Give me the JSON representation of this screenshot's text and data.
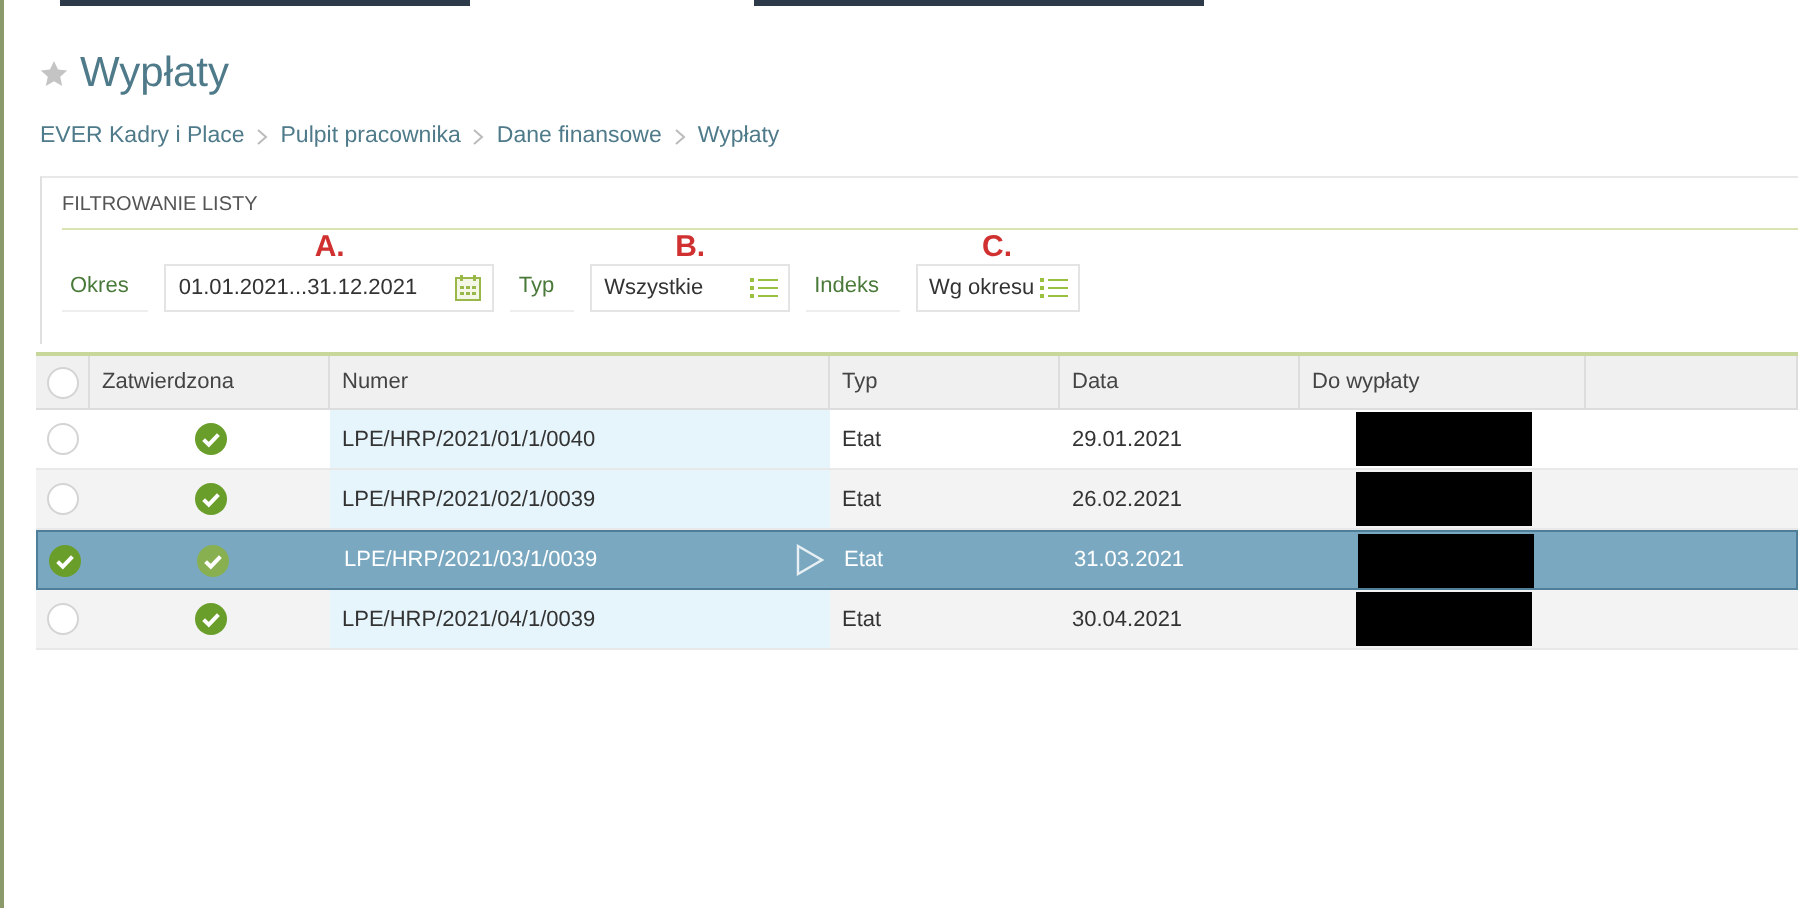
{
  "page": {
    "title": "Wypłaty",
    "favorite": false
  },
  "breadcrumb": [
    "EVER Kadry i Place",
    "Pulpit pracownika",
    "Dane finansowe",
    "Wypłaty"
  ],
  "filter": {
    "title": "FILTROWANIE LISTY",
    "fields": [
      {
        "marker": "A.",
        "label": "Okres",
        "value": "01.01.2021...31.12.2021",
        "kind": "date"
      },
      {
        "marker": "B.",
        "label": "Typ",
        "value": "Wszystkie",
        "kind": "list"
      },
      {
        "marker": "C.",
        "label": "Indeks",
        "value": "Wg okresu",
        "kind": "list"
      }
    ]
  },
  "table": {
    "columns": [
      "Zatwierdzona",
      "Numer",
      "Typ",
      "Data",
      "Do wypłaty"
    ],
    "all_selected": false,
    "rows": [
      {
        "selected": false,
        "approved": true,
        "number": "LPE/HRP/2021/01/1/0040",
        "type": "Etat",
        "date": "29.01.2021",
        "amount_redacted": true
      },
      {
        "selected": false,
        "approved": true,
        "number": "LPE/HRP/2021/02/1/0039",
        "type": "Etat",
        "date": "26.02.2021",
        "amount_redacted": true
      },
      {
        "selected": true,
        "approved": true,
        "number": "LPE/HRP/2021/03/1/0039",
        "type": "Etat",
        "date": "31.03.2021",
        "amount_redacted": true
      },
      {
        "selected": false,
        "approved": true,
        "number": "LPE/HRP/2021/04/1/0039",
        "type": "Etat",
        "date": "30.04.2021",
        "amount_redacted": true
      }
    ]
  }
}
